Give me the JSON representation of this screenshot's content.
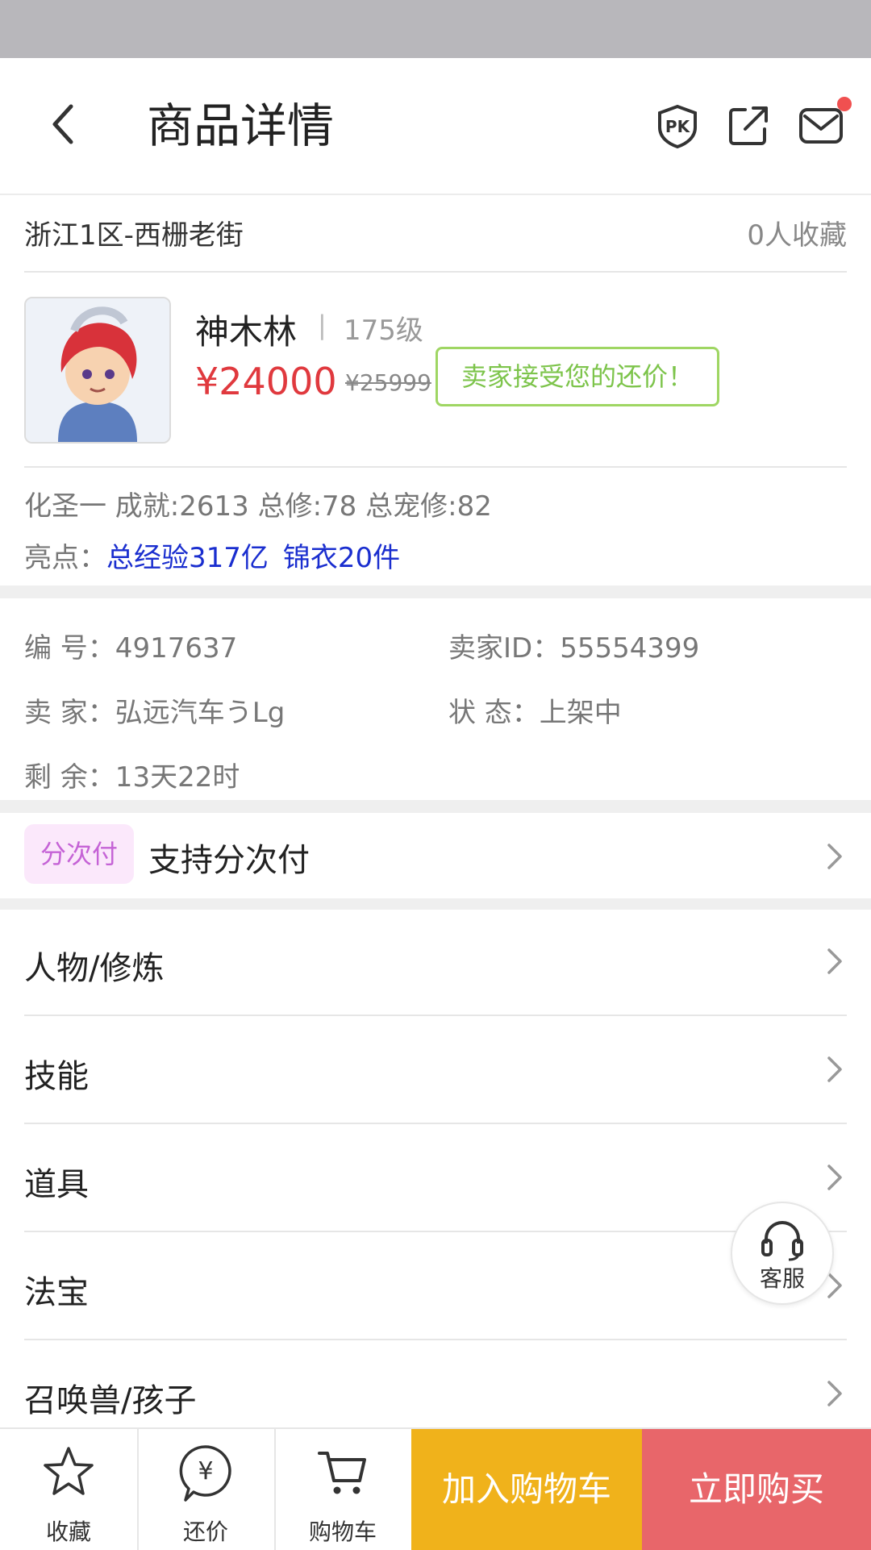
{
  "header": {
    "title": "商品详情"
  },
  "server": {
    "name": "浙江1区-西栅老街",
    "favorites": "0人收藏"
  },
  "item": {
    "name": "神木林",
    "separator": "|",
    "level": "175级",
    "price": "¥24000",
    "original_price": "¥25999",
    "badge": "卖家接受您的还价！",
    "stats": "化圣一 成就:2613 总修:78 总宠修:82",
    "highlight_label": "亮点：",
    "highlights": [
      "总经验317亿",
      "锦衣20件"
    ]
  },
  "info": {
    "number": "编  号：4917637",
    "seller_id": "卖家ID：55554399",
    "seller": "卖  家：弘远汽车うLg",
    "status": "状  态：上架中",
    "remaining": "剩  余：13天22时"
  },
  "installment": {
    "pill": "分次付",
    "label": "支持分次付"
  },
  "menu": [
    {
      "label": "人物/修炼"
    },
    {
      "label": "技能"
    },
    {
      "label": "道具"
    },
    {
      "label": "法宝"
    },
    {
      "label": "召唤兽/孩子"
    }
  ],
  "service": {
    "label": "客服"
  },
  "bottom": {
    "favorite": "收藏",
    "bargain": "还价",
    "cart": "购物车",
    "add_cart": "加入购物车",
    "buy_now": "立即购买"
  },
  "colors": {
    "price": "#e0393e",
    "cart_btn": "#f0b21b",
    "buy_btn": "#e8666a",
    "highlight": "#1a2ecf"
  }
}
